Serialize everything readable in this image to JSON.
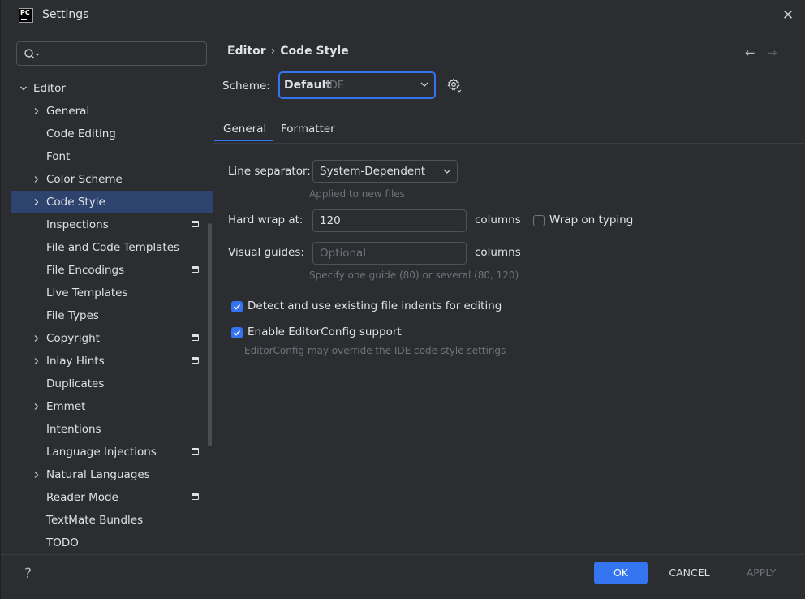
{
  "window": {
    "title": "Settings",
    "app_icon_text": "PC",
    "close_glyph": "✕"
  },
  "breadcrumb": {
    "parent": "Editor",
    "separator": "›",
    "current": "Code Style",
    "back_glyph": "←",
    "forward_glyph": "→"
  },
  "sidebar": {
    "items": [
      {
        "label": "Editor",
        "level": 0,
        "expandable": true,
        "expanded": true,
        "bold": true
      },
      {
        "label": "General",
        "level": 1,
        "expandable": true
      },
      {
        "label": "Code Editing",
        "level": 1
      },
      {
        "label": "Font",
        "level": 1
      },
      {
        "label": "Color Scheme",
        "level": 1,
        "expandable": true
      },
      {
        "label": "Code Style",
        "level": 1,
        "expandable": true,
        "selected": true
      },
      {
        "label": "Inspections",
        "level": 1,
        "modified": true
      },
      {
        "label": "File and Code Templates",
        "level": 1
      },
      {
        "label": "File Encodings",
        "level": 1,
        "modified": true
      },
      {
        "label": "Live Templates",
        "level": 1
      },
      {
        "label": "File Types",
        "level": 1
      },
      {
        "label": "Copyright",
        "level": 1,
        "expandable": true,
        "modified": true
      },
      {
        "label": "Inlay Hints",
        "level": 1,
        "expandable": true,
        "modified": true
      },
      {
        "label": "Duplicates",
        "level": 1
      },
      {
        "label": "Emmet",
        "level": 1,
        "expandable": true
      },
      {
        "label": "Intentions",
        "level": 1
      },
      {
        "label": "Language Injections",
        "level": 1,
        "modified": true
      },
      {
        "label": "Natural Languages",
        "level": 1,
        "expandable": true
      },
      {
        "label": "Reader Mode",
        "level": 1,
        "modified": true
      },
      {
        "label": "TextMate Bundles",
        "level": 1
      },
      {
        "label": "TODO",
        "level": 1
      }
    ]
  },
  "scheme": {
    "label": "Scheme:",
    "value": "Default",
    "sub": "IDE"
  },
  "tabs": [
    {
      "label": "General",
      "active": true
    },
    {
      "label": "Formatter",
      "active": false
    }
  ],
  "general": {
    "line_separator_label": "Line separator:",
    "line_separator_value": "System-Dependent",
    "line_separator_hint": "Applied to new files",
    "hard_wrap_label": "Hard wrap at:",
    "hard_wrap_value": "120",
    "hard_wrap_unit": "columns",
    "wrap_on_typing_label": "Wrap on typing",
    "wrap_on_typing_checked": false,
    "visual_guides_label": "Visual guides:",
    "visual_guides_placeholder": "Optional",
    "visual_guides_unit": "columns",
    "visual_guides_hint": "Specify one guide (80) or several (80, 120)",
    "detect_indents_label": "Detect and use existing file indents for editing",
    "detect_indents_checked": true,
    "editorconfig_label": "Enable EditorConfig support",
    "editorconfig_checked": true,
    "editorconfig_hint": "EditorConfig may override the IDE code style settings"
  },
  "footer": {
    "help": "?",
    "ok": "OK",
    "cancel": "CANCEL",
    "apply": "APPLY"
  },
  "colors": {
    "background": "#2b2d30",
    "accent": "#3574f0",
    "selection": "#2e436e",
    "text": "#dfe1e5",
    "muted": "#6f737a"
  }
}
